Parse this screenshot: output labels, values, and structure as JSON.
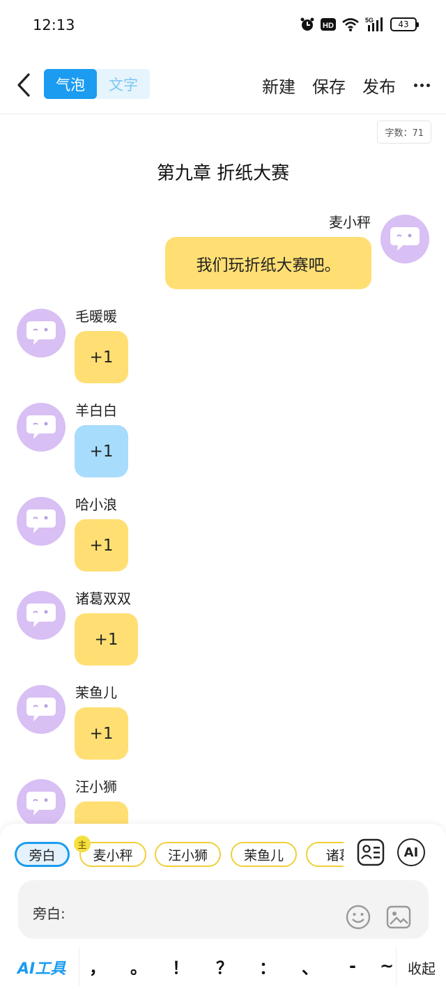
{
  "status_bar": {
    "time": "12:13",
    "network": "5G",
    "battery": "43"
  },
  "topbar": {
    "mode_tabs": [
      "气泡",
      "文字"
    ],
    "actions": [
      "新建",
      "保存",
      "发布"
    ]
  },
  "word_count": "字数：71",
  "chapter_title": "第九章 折纸大赛",
  "messages": [
    {
      "side": "right",
      "name": "麦小秤",
      "text": "我们玩折纸大赛吧。",
      "color": "#ffdf73"
    },
    {
      "side": "left",
      "name": "毛暖暖",
      "text": "+1",
      "color": "#ffdf73"
    },
    {
      "side": "left",
      "name": "羊白白",
      "text": "+1",
      "color": "#a7dcfd"
    },
    {
      "side": "left",
      "name": "哈小浪",
      "text": "+1",
      "color": "#ffdf73"
    },
    {
      "side": "left",
      "name": "诸葛双双",
      "text": "+1",
      "color": "#ffdf73"
    },
    {
      "side": "left",
      "name": "茉鱼儿",
      "text": "+1",
      "color": "#ffdf73"
    },
    {
      "side": "left",
      "name": "汪小狮",
      "text": "",
      "color": "#ffdf73"
    }
  ],
  "bottom": {
    "chips": [
      "旁白",
      "麦小秤",
      "汪小狮",
      "茉鱼儿",
      "诸葛"
    ],
    "main_badge": "主",
    "ai_button": "AI",
    "input_prefix": "旁白:",
    "input_value": "",
    "ai_tools": "AI工具",
    "punctuation": [
      "，",
      "。",
      "！",
      "？",
      "：",
      "、",
      "-",
      "~"
    ],
    "collapse": "收起"
  },
  "colors": {
    "accent": "#1b9cf0",
    "avatar": "#d8bff4",
    "bubble_yellow": "#ffdf73",
    "bubble_blue": "#a7dcfd",
    "chip_border": "#f0cf3a"
  }
}
